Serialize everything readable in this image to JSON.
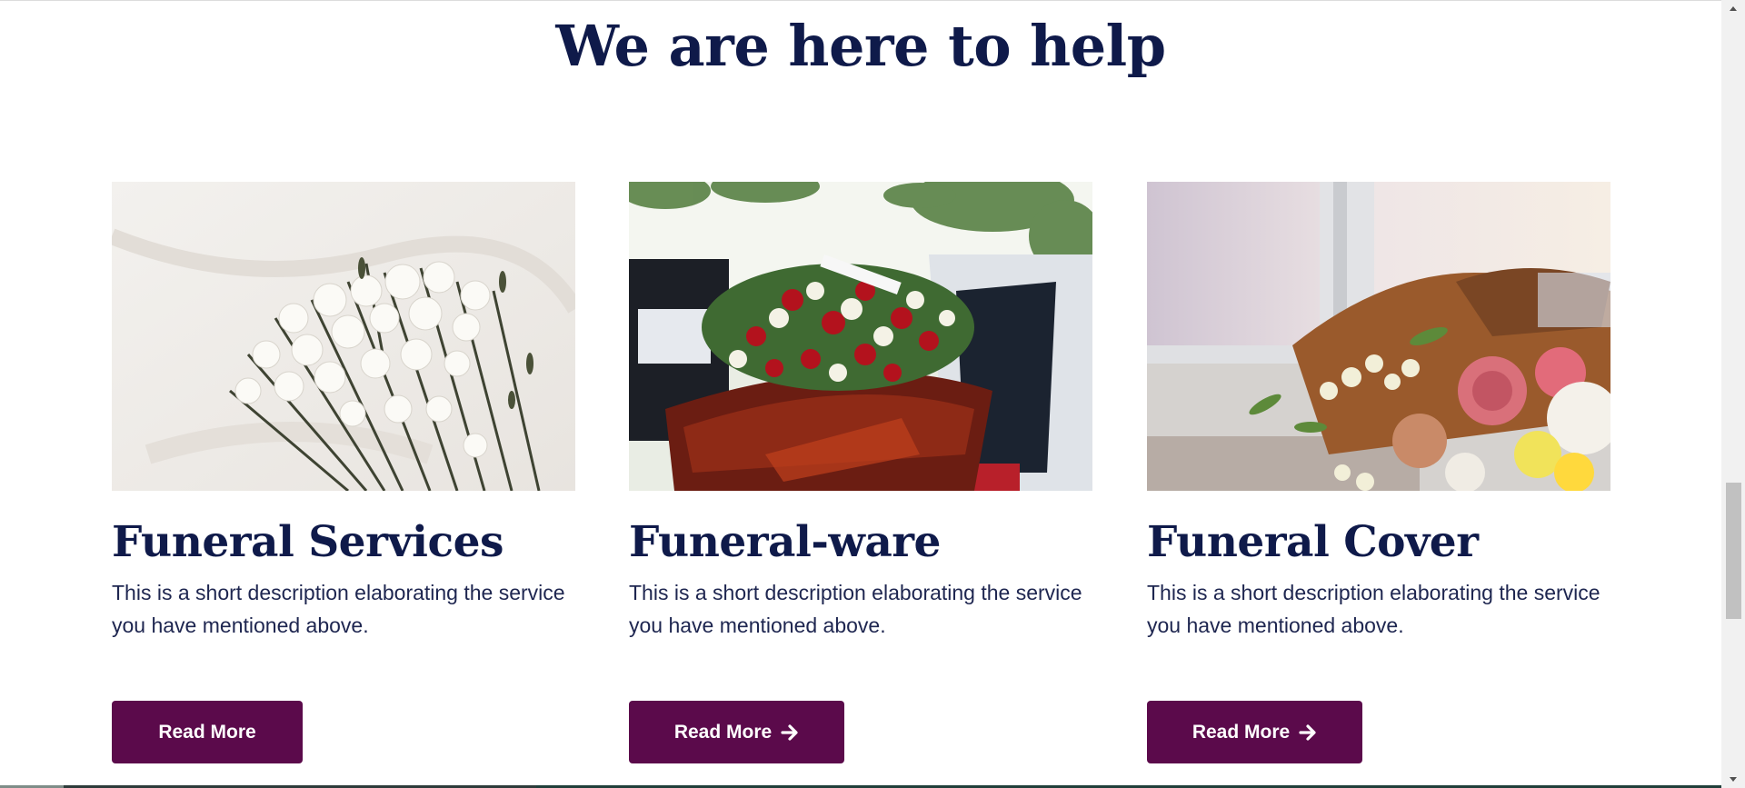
{
  "section": {
    "heading": "We are here to help"
  },
  "cards": [
    {
      "title": "Funeral Services",
      "description": "This is a short description elaborating the service you have mentioned above.",
      "button_label": "Read More",
      "image_icon": "white-carnations-bouquet-image"
    },
    {
      "title": "Funeral-ware",
      "description": "This is a short description elaborating the service you have mentioned above.",
      "button_label": "Read More",
      "button_icon": "arrow-right-icon",
      "image_icon": "casket-flower-spray-image"
    },
    {
      "title": "Funeral Cover",
      "description": "This is a short description elaborating the service you have mentioned above.",
      "button_label": "Read More",
      "button_icon": "arrow-right-icon",
      "image_icon": "wrapped-bouquet-window-image"
    }
  ],
  "colors": {
    "heading": "#0f1a4a",
    "body_text": "#1e2650",
    "button_bg": "#5b0a4b",
    "button_text": "#ffffff",
    "background": "#ffffff"
  }
}
